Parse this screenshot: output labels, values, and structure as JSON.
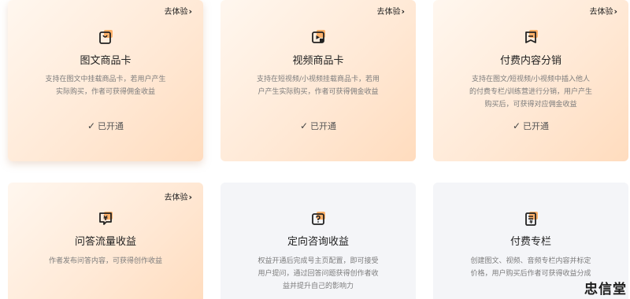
{
  "cards": [
    {
      "try_label": "去体验",
      "icon": "shopping-bag-icon",
      "title": "图文商品卡",
      "desc": [
        "支持在图文中挂载商品卡，若用户产生",
        "实际购买，作者可获得佣金收益"
      ],
      "status": "已开通"
    },
    {
      "try_label": "去体验",
      "icon": "video-product-icon",
      "title": "视频商品卡",
      "desc": [
        "支持在短视频/小视频挂载商品卡，若用",
        "户产生实际购买，作者可获得佣金收益"
      ],
      "status": "已开通"
    },
    {
      "try_label": "去体验",
      "icon": "paid-content-icon",
      "title": "付费内容分销",
      "desc": [
        "支持在图文/短视频/小视频中插入他人",
        "的付费专栏/训练营进行分销，用户产生",
        "购买后，可获得对应佣金收益"
      ],
      "status": "已开通"
    },
    {
      "try_label": "去体验",
      "icon": "qa-income-icon",
      "title": "问答流量收益",
      "desc": [
        "作者发布问答内容，可获得创作收益"
      ]
    },
    {
      "icon": "consult-icon",
      "title": "定向咨询收益",
      "desc": [
        "权益开通后完成号主页配置，即可接受",
        "用户提问，通过回答问题获得创作者收",
        "益并提升自己的影响力"
      ]
    },
    {
      "icon": "paid-column-icon",
      "title": "付费专栏",
      "desc": [
        "创建图文、视频、音频专栏内容并标定",
        "价格，用户购买后作者可获得收益分成"
      ]
    }
  ],
  "watermark": "忠信堂",
  "colors": {
    "accent": "#ff9c3a",
    "warm_bg": "#ffe9d6",
    "cool_bg": "#f4f5f8"
  }
}
